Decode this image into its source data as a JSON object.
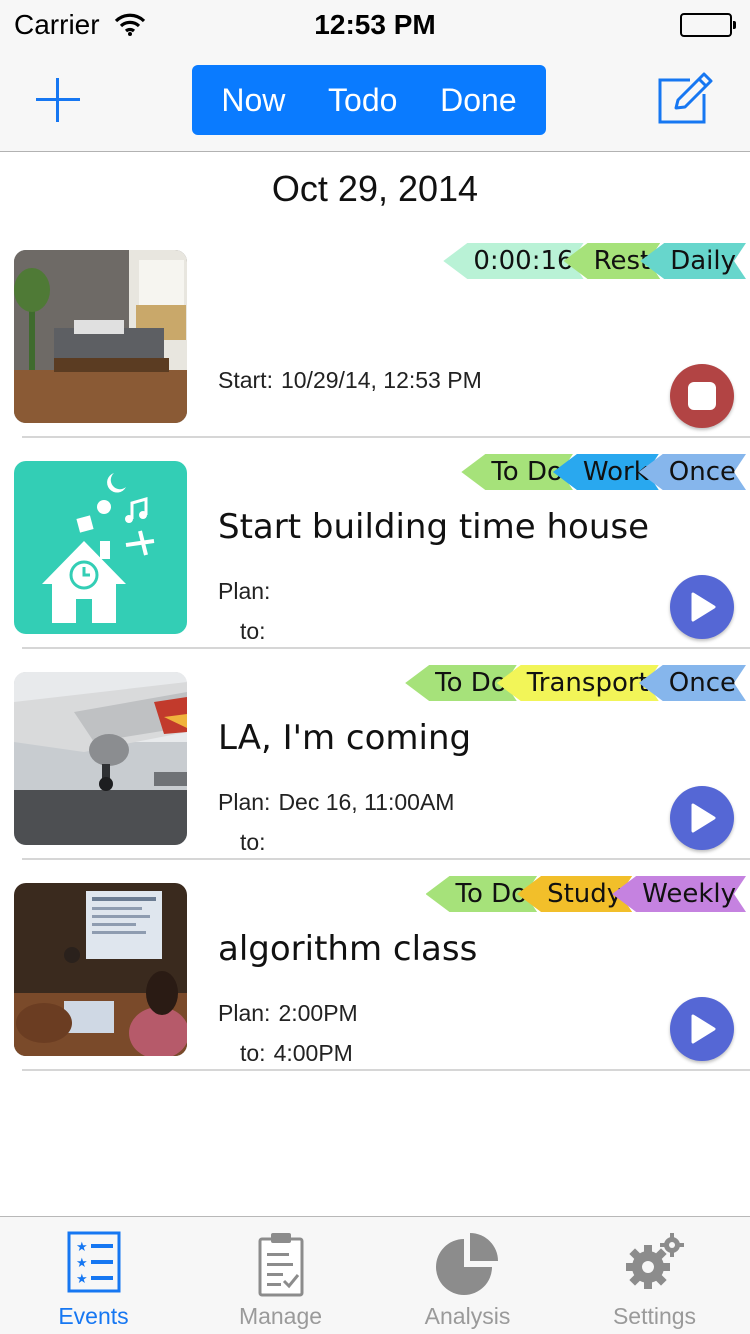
{
  "status_bar": {
    "carrier": "Carrier",
    "time": "12:53 PM"
  },
  "nav": {
    "segments": [
      "Now",
      "Todo",
      "Done"
    ],
    "accent": "#0a7bff"
  },
  "date_header": "Oct 29, 2014",
  "events": [
    {
      "tags": [
        {
          "label": "0:00:16",
          "color": "#b9f2d6"
        },
        {
          "label": "Rest",
          "color": "#a6e27a"
        },
        {
          "label": "Daily",
          "color": "#67d6cc"
        }
      ],
      "title": "",
      "line1": {
        "key": "Start:",
        "value": "10/29/14, 12:53 PM"
      },
      "line2": {
        "key": "",
        "value": ""
      },
      "action": "stop"
    },
    {
      "tags": [
        {
          "label": "To Do",
          "color": "#a6e27a"
        },
        {
          "label": "Work",
          "color": "#29a8ef"
        },
        {
          "label": "Once",
          "color": "#86b6ec"
        }
      ],
      "title": "Start building time house",
      "line1": {
        "key": "Plan:",
        "value": ""
      },
      "line2": {
        "key": "to:",
        "value": ""
      },
      "action": "play"
    },
    {
      "tags": [
        {
          "label": "To Do",
          "color": "#a6e27a"
        },
        {
          "label": "Transport",
          "color": "#f2f558"
        },
        {
          "label": "Once",
          "color": "#86b6ec"
        }
      ],
      "title": "LA, I'm coming",
      "line1": {
        "key": "Plan:",
        "value": "Dec 16, 11:00AM"
      },
      "line2": {
        "key": "to:",
        "value": ""
      },
      "action": "play"
    },
    {
      "tags": [
        {
          "label": "To Do",
          "color": "#a6e27a"
        },
        {
          "label": "Study",
          "color": "#f2bf2a"
        },
        {
          "label": "Weekly",
          "color": "#c582e0"
        }
      ],
      "title": "algorithm class",
      "line1": {
        "key": "Plan:",
        "value": "2:00PM"
      },
      "line2": {
        "key": "to:",
        "value": "4:00PM"
      },
      "action": "play"
    }
  ],
  "tabs": [
    {
      "label": "Events",
      "icon": "list-icon",
      "active": true
    },
    {
      "label": "Manage",
      "icon": "clipboard-icon",
      "active": false
    },
    {
      "label": "Analysis",
      "icon": "pie-chart-icon",
      "active": false
    },
    {
      "label": "Settings",
      "icon": "gears-icon",
      "active": false
    }
  ]
}
